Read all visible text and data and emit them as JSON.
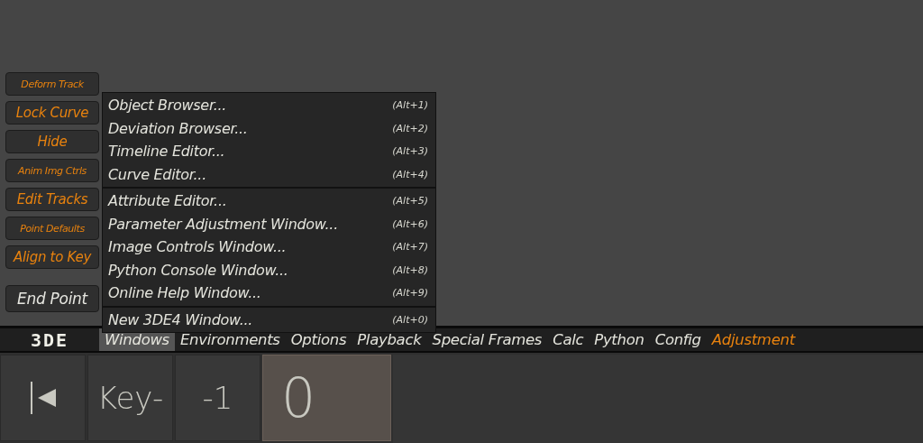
{
  "side_buttons": [
    {
      "label": "Deform Track",
      "kind": "accent",
      "compact": true
    },
    {
      "label": "Lock Curve",
      "kind": "accent",
      "compact": false
    },
    {
      "label": "Hide",
      "kind": "accent",
      "compact": false
    },
    {
      "label": "Anim Img Ctrls",
      "kind": "accent",
      "compact": true
    },
    {
      "label": "Edit Tracks",
      "kind": "accent",
      "compact": false
    },
    {
      "label": "Point Defaults",
      "kind": "accent",
      "compact": true
    },
    {
      "label": "Align to Key",
      "kind": "accent",
      "compact": false
    },
    {
      "label": "End Point",
      "kind": "plain",
      "compact": false
    }
  ],
  "windows_menu": {
    "groups": [
      [
        {
          "label": "Object Browser...",
          "shortcut": "(Alt+1)"
        },
        {
          "label": "Deviation Browser...",
          "shortcut": "(Alt+2)"
        },
        {
          "label": "Timeline Editor...",
          "shortcut": "(Alt+3)"
        },
        {
          "label": "Curve Editor...",
          "shortcut": "(Alt+4)"
        }
      ],
      [
        {
          "label": "Attribute Editor...",
          "shortcut": "(Alt+5)"
        },
        {
          "label": "Parameter Adjustment Window...",
          "shortcut": "(Alt+6)"
        },
        {
          "label": "Image Controls Window...",
          "shortcut": "(Alt+7)"
        },
        {
          "label": "Python Console Window...",
          "shortcut": "(Alt+8)"
        },
        {
          "label": "Online Help Window...",
          "shortcut": "(Alt+9)"
        }
      ],
      [
        {
          "label": "New 3DE4 Window...",
          "shortcut": "(Alt+0)"
        }
      ]
    ]
  },
  "menu_bar": {
    "logo": "3DE",
    "items": [
      {
        "label": "Windows",
        "selected": true,
        "accent": false
      },
      {
        "label": "Environments",
        "selected": false,
        "accent": false
      },
      {
        "label": "Options",
        "selected": false,
        "accent": false
      },
      {
        "label": "Playback",
        "selected": false,
        "accent": false
      },
      {
        "label": "Special Frames",
        "selected": false,
        "accent": false
      },
      {
        "label": "Calc",
        "selected": false,
        "accent": false
      },
      {
        "label": "Python",
        "selected": false,
        "accent": false
      },
      {
        "label": "Config",
        "selected": false,
        "accent": false
      },
      {
        "label": "Adjustment",
        "selected": false,
        "accent": true
      }
    ]
  },
  "timeline_controls": [
    {
      "kind": "icon",
      "selected": false
    },
    {
      "kind": "text",
      "label": "Key-",
      "selected": false
    },
    {
      "kind": "text",
      "label": "-1",
      "selected": false
    },
    {
      "kind": "frame",
      "label": "0",
      "selected": true
    }
  ]
}
